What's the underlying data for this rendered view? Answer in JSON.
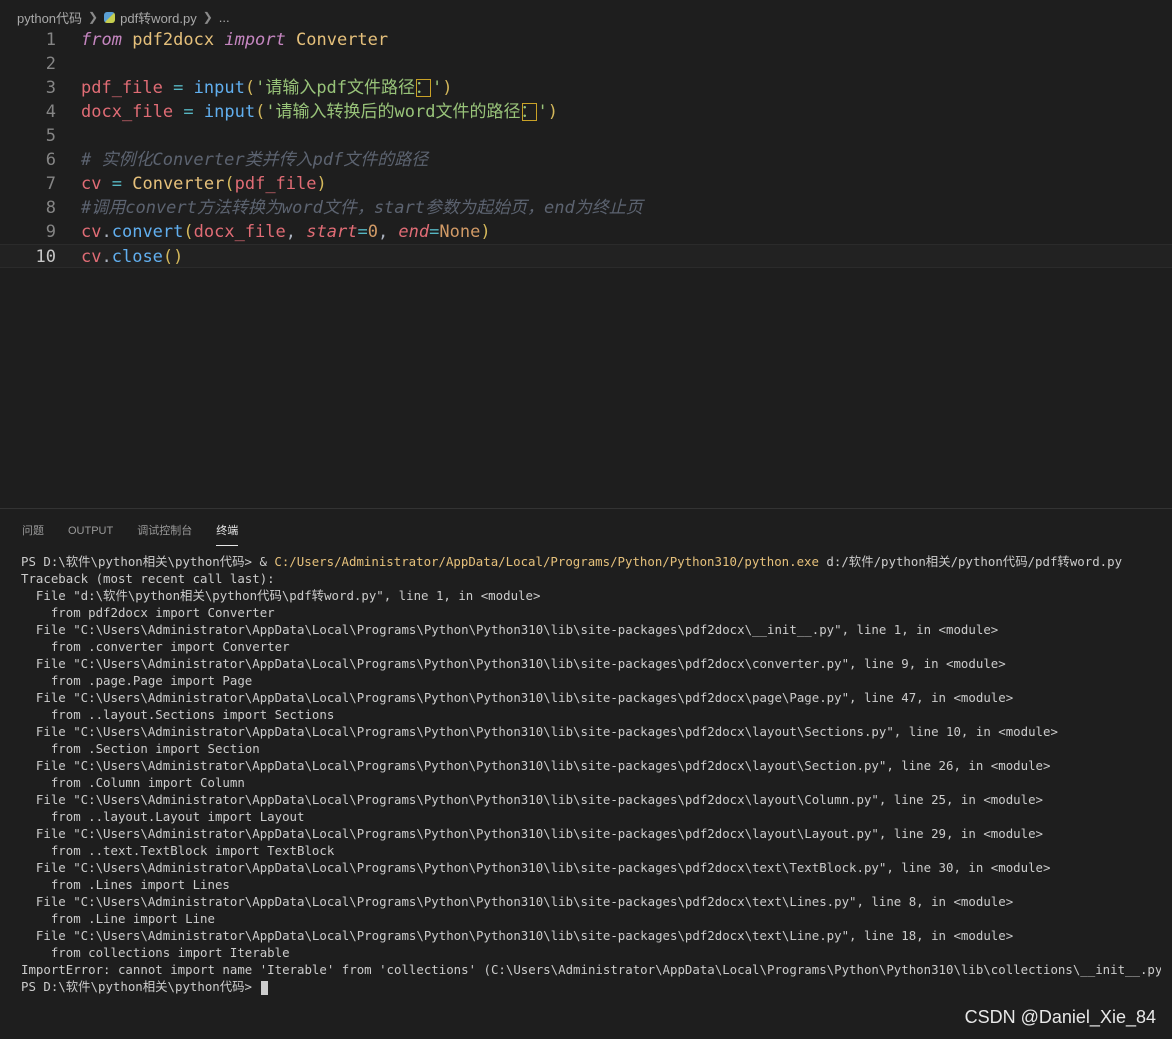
{
  "breadcrumb": {
    "folder": "python代码",
    "file": "pdf转word.py",
    "more": "..."
  },
  "editor": {
    "lines": [
      {
        "num": "1",
        "parts": [
          {
            "t": "from",
            "c": "kw"
          },
          {
            "t": " ",
            "c": "plain"
          },
          {
            "t": "pdf2docx",
            "c": "mod"
          },
          {
            "t": " ",
            "c": "plain"
          },
          {
            "t": "import",
            "c": "kw"
          },
          {
            "t": " ",
            "c": "plain"
          },
          {
            "t": "Converter",
            "c": "cls"
          }
        ]
      },
      {
        "num": "2",
        "parts": []
      },
      {
        "num": "3",
        "parts": [
          {
            "t": "pdf_file",
            "c": "var"
          },
          {
            "t": " ",
            "c": "plain"
          },
          {
            "t": "=",
            "c": "op"
          },
          {
            "t": " ",
            "c": "plain"
          },
          {
            "t": "input",
            "c": "fn"
          },
          {
            "t": "(",
            "c": "pn"
          },
          {
            "t": "'请输入pdf文件路径",
            "c": "str"
          },
          {
            "t": "：",
            "c": "str boxed"
          },
          {
            "t": "'",
            "c": "str"
          },
          {
            "t": ")",
            "c": "pn"
          }
        ]
      },
      {
        "num": "4",
        "parts": [
          {
            "t": "docx_file",
            "c": "var"
          },
          {
            "t": " ",
            "c": "plain"
          },
          {
            "t": "=",
            "c": "op"
          },
          {
            "t": " ",
            "c": "plain"
          },
          {
            "t": "input",
            "c": "fn"
          },
          {
            "t": "(",
            "c": "pn"
          },
          {
            "t": "'请输入转换后的word文件的路径",
            "c": "str"
          },
          {
            "t": "：",
            "c": "str boxed"
          },
          {
            "t": "'",
            "c": "str"
          },
          {
            "t": ")",
            "c": "pn"
          }
        ]
      },
      {
        "num": "5",
        "parts": []
      },
      {
        "num": "6",
        "parts": [
          {
            "t": "# 实例化Converter类并传入pdf文件的路径",
            "c": "cm"
          }
        ]
      },
      {
        "num": "7",
        "parts": [
          {
            "t": "cv",
            "c": "var"
          },
          {
            "t": " ",
            "c": "plain"
          },
          {
            "t": "=",
            "c": "op"
          },
          {
            "t": " ",
            "c": "plain"
          },
          {
            "t": "Converter",
            "c": "cls"
          },
          {
            "t": "(",
            "c": "pn"
          },
          {
            "t": "pdf_file",
            "c": "var"
          },
          {
            "t": ")",
            "c": "pn"
          }
        ]
      },
      {
        "num": "8",
        "parts": [
          {
            "t": "#调用convert方法转换为word文件，start参数为起始页，end为终止页",
            "c": "cm"
          }
        ]
      },
      {
        "num": "9",
        "parts": [
          {
            "t": "cv",
            "c": "var"
          },
          {
            "t": ".",
            "c": "plain"
          },
          {
            "t": "convert",
            "c": "fn"
          },
          {
            "t": "(",
            "c": "pn"
          },
          {
            "t": "docx_file",
            "c": "var"
          },
          {
            "t": ", ",
            "c": "plain"
          },
          {
            "t": "start",
            "c": "kwa"
          },
          {
            "t": "=",
            "c": "op"
          },
          {
            "t": "0",
            "c": "num"
          },
          {
            "t": ", ",
            "c": "plain"
          },
          {
            "t": "end",
            "c": "kwa"
          },
          {
            "t": "=",
            "c": "op"
          },
          {
            "t": "None",
            "c": "none"
          },
          {
            "t": ")",
            "c": "pn"
          }
        ]
      },
      {
        "num": "10",
        "parts": [
          {
            "t": "cv",
            "c": "var"
          },
          {
            "t": ".",
            "c": "plain"
          },
          {
            "t": "close",
            "c": "fn"
          },
          {
            "t": "(",
            "c": "pn"
          },
          {
            "t": ")",
            "c": "pn"
          }
        ]
      }
    ]
  },
  "panel": {
    "tabs": [
      "问题",
      "OUTPUT",
      "调试控制台",
      "终端"
    ],
    "active_tab": "终端",
    "terminal_lines": [
      {
        "prompt": "PS D:\\软件\\python相关\\python代码> & ",
        "cmd": "C:/Users/Administrator/AppData/Local/Programs/Python/Python310/python.exe",
        "rest": " d:/软件/python相关/python代码/pdf转word.py"
      },
      {
        "text": "Traceback (most recent call last):"
      },
      {
        "text": "  File \"d:\\软件\\python相关\\python代码\\pdf转word.py\", line 1, in <module>"
      },
      {
        "text": "    from pdf2docx import Converter"
      },
      {
        "text": "  File \"C:\\Users\\Administrator\\AppData\\Local\\Programs\\Python\\Python310\\lib\\site-packages\\pdf2docx\\__init__.py\", line 1, in <module>"
      },
      {
        "text": "    from .converter import Converter"
      },
      {
        "text": "  File \"C:\\Users\\Administrator\\AppData\\Local\\Programs\\Python\\Python310\\lib\\site-packages\\pdf2docx\\converter.py\", line 9, in <module>"
      },
      {
        "text": "    from .page.Page import Page"
      },
      {
        "text": "  File \"C:\\Users\\Administrator\\AppData\\Local\\Programs\\Python\\Python310\\lib\\site-packages\\pdf2docx\\page\\Page.py\", line 47, in <module>"
      },
      {
        "text": "    from ..layout.Sections import Sections"
      },
      {
        "text": "  File \"C:\\Users\\Administrator\\AppData\\Local\\Programs\\Python\\Python310\\lib\\site-packages\\pdf2docx\\layout\\Sections.py\", line 10, in <module>"
      },
      {
        "text": "    from .Section import Section"
      },
      {
        "text": "  File \"C:\\Users\\Administrator\\AppData\\Local\\Programs\\Python\\Python310\\lib\\site-packages\\pdf2docx\\layout\\Section.py\", line 26, in <module>"
      },
      {
        "text": "    from .Column import Column"
      },
      {
        "text": "  File \"C:\\Users\\Administrator\\AppData\\Local\\Programs\\Python\\Python310\\lib\\site-packages\\pdf2docx\\layout\\Column.py\", line 25, in <module>"
      },
      {
        "text": "    from ..layout.Layout import Layout"
      },
      {
        "text": "  File \"C:\\Users\\Administrator\\AppData\\Local\\Programs\\Python\\Python310\\lib\\site-packages\\pdf2docx\\layout\\Layout.py\", line 29, in <module>"
      },
      {
        "text": "    from ..text.TextBlock import TextBlock"
      },
      {
        "text": "  File \"C:\\Users\\Administrator\\AppData\\Local\\Programs\\Python\\Python310\\lib\\site-packages\\pdf2docx\\text\\TextBlock.py\", line 30, in <module>"
      },
      {
        "text": "    from .Lines import Lines"
      },
      {
        "text": "  File \"C:\\Users\\Administrator\\AppData\\Local\\Programs\\Python\\Python310\\lib\\site-packages\\pdf2docx\\text\\Lines.py\", line 8, in <module>"
      },
      {
        "text": "    from .Line import Line"
      },
      {
        "text": "  File \"C:\\Users\\Administrator\\AppData\\Local\\Programs\\Python\\Python310\\lib\\site-packages\\pdf2docx\\text\\Line.py\", line 18, in <module>"
      },
      {
        "text": "    from collections import Iterable"
      },
      {
        "text": "ImportError: cannot import name 'Iterable' from 'collections' (C:\\Users\\Administrator\\AppData\\Local\\Programs\\Python\\Python310\\lib\\collections\\__init__.py)"
      },
      {
        "text": "PS D:\\软件\\python相关\\python代码> "
      }
    ]
  },
  "watermark": "CSDN @Daniel_Xie_84"
}
